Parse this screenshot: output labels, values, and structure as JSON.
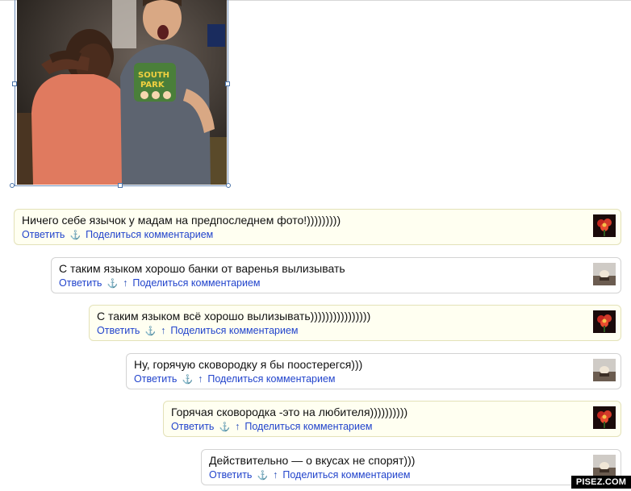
{
  "photo": {
    "alt": "",
    "selected": true
  },
  "comments": [
    {
      "text": "Ничего себе язычок у мадам на предпоследнем фото!)))))))))",
      "reply": "Ответить",
      "anchor": "⚓",
      "up": "",
      "share": "Поделиться комментарием",
      "avatar": "red-flower-avatar",
      "highlighted": true
    },
    {
      "text": "С таким языком хорошо банки от варенья вылизывать",
      "reply": "Ответить",
      "anchor": "⚓",
      "up": "↑",
      "share": "Поделиться комментарием",
      "avatar": "gray-photo-avatar",
      "highlighted": false
    },
    {
      "text": "С таким языком всё хорошо вылизывать))))))))))))))))",
      "reply": "Ответить",
      "anchor": "⚓",
      "up": "↑",
      "share": "Поделиться комментарием",
      "avatar": "red-flower-avatar",
      "highlighted": true
    },
    {
      "text": "Ну, горячую сковородку я бы поостерегся)))",
      "reply": "Ответить",
      "anchor": "⚓",
      "up": "↑",
      "share": "Поделиться комментарием",
      "avatar": "gray-photo-avatar",
      "highlighted": false
    },
    {
      "text": "Горячая сковородка -это на любителя))))))))))",
      "reply": "Ответить",
      "anchor": "⚓",
      "up": "↑",
      "share": "Поделиться комментарием",
      "avatar": "red-flower-avatar",
      "highlighted": true
    },
    {
      "text": "Действительно — о вкусах не спорят)))",
      "reply": "Ответить",
      "anchor": "⚓",
      "up": "↑",
      "share": "Поделиться комментарием",
      "avatar": "gray-photo-avatar",
      "highlighted": false
    }
  ],
  "watermark": "PISEZ.COM",
  "colors": {
    "link": "#2244cc",
    "highlight_bg": "#fffff1",
    "border": "#d3d3d3"
  }
}
